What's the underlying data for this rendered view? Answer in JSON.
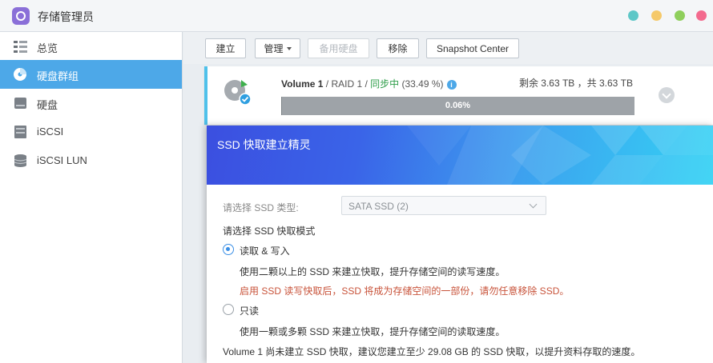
{
  "window": {
    "title": "存储管理员",
    "controls": [
      {
        "name": "help",
        "color": "#5ec7c7"
      },
      {
        "name": "minimize",
        "color": "#f5c96a"
      },
      {
        "name": "maximize",
        "color": "#8fcf5c"
      },
      {
        "name": "close",
        "color": "#f36a8e"
      }
    ]
  },
  "sidebar": {
    "items": [
      {
        "label": "总览",
        "icon": "overview-icon",
        "active": false
      },
      {
        "label": "硬盘群组",
        "icon": "disk-group-icon",
        "active": true
      },
      {
        "label": "硬盘",
        "icon": "hard-disk-icon",
        "active": false
      },
      {
        "label": "iSCSI",
        "icon": "iscsi-icon",
        "active": false
      },
      {
        "label": "iSCSI LUN",
        "icon": "iscsi-lun-icon",
        "active": false
      }
    ]
  },
  "toolbar": {
    "create": "建立",
    "manage": "管理",
    "spare": "备用硬盘",
    "remove": "移除",
    "snapshot": "Snapshot Center"
  },
  "volume": {
    "name": "Volume 1",
    "raid": " / RAID 1 / ",
    "status": "同步中",
    "status_pct": " (33.49 %)",
    "info_icon": "i",
    "capacity": "剩余 3.63 TB ，共 3.63 TB",
    "progress_label": "0.06%",
    "progress_value": 0.06,
    "accent": "#4fc1ea"
  },
  "wizard": {
    "title": "SSD 快取建立精灵",
    "ssd_type_label": "请选择 SSD 类型:",
    "ssd_type_value": "SATA SSD (2)",
    "mode_label": "请选择 SSD 快取模式",
    "option_rw": {
      "label": "读取 & 写入",
      "desc": "使用二颗以上的 SSD 来建立快取，提升存储空间的读写速度。",
      "warning": "启用 SSD 读写快取后，SSD 将成为存储空间的一部份，请勿任意移除 SSD。",
      "selected": true
    },
    "option_ro": {
      "label": "只读",
      "desc": "使用一颗或多颗 SSD 来建立快取，提升存储空间的读取速度。",
      "selected": false
    },
    "note": "Volume 1 尚未建立 SSD 快取，建议您建立至少 29.08 GB 的 SSD 快取，以提升资料存取的速度。"
  }
}
